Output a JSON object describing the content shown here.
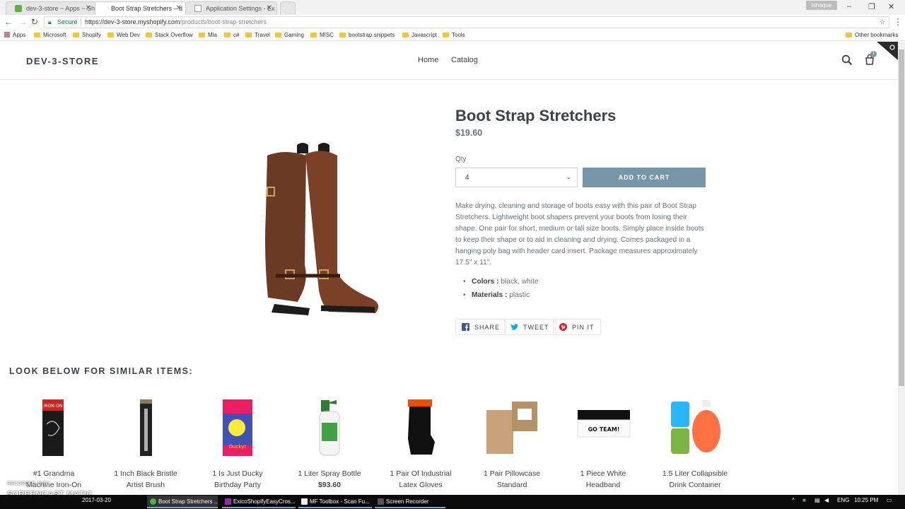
{
  "browser": {
    "tabs": [
      {
        "label": "dev-3-store ~ Apps ~ Sh",
        "active": false
      },
      {
        "label": "Boot Strap Stretchers – d",
        "active": true
      },
      {
        "label": "Application Settings - Ex",
        "active": false
      }
    ],
    "user_badge": "Ishaque",
    "secure_label": "Secure",
    "url_host": "https://dev-3-store.myshopify.com",
    "url_path": "/products/boot-strap-stretchers",
    "bookmarks": [
      "Apps",
      "Microsoft",
      "Shopify",
      "Web Dev",
      "Stack Overflow",
      "Mia",
      "c#",
      "Travel",
      "Gaming",
      "MISC",
      "bootstrap snippets",
      "Javascript",
      "Tools"
    ],
    "other_bookmarks": "Other bookmarks"
  },
  "store": {
    "logo": "DEV-3-STORE",
    "nav": [
      "Home",
      "Catalog"
    ],
    "cart_count": "1"
  },
  "product": {
    "title": "Boot Strap Stretchers",
    "price": "$19.60",
    "qty_label": "Qty",
    "qty_value": "4",
    "add_to_cart": "ADD TO CART",
    "description": "Make drying, cleaning and storage of boots easy with this pair of Boot Strap Stretchers. Lightweight boot shapers prevent your boots from losing their shape. One pair for short, medium or tall size boots. Simply place inside boots to keep their shape or to aid in cleaning and drying. Comes packaged in a hanging poly bag with header card insert. Package measures approximately 17.5\" x 11\".",
    "attributes": [
      {
        "label": "Colors :",
        "value": "black, white"
      },
      {
        "label": "Materials :",
        "value": "plastic"
      }
    ],
    "share": [
      "SHARE",
      "TWEET",
      "PIN IT"
    ]
  },
  "similar": {
    "heading": "LOOK BELOW FOR SIMILAR ITEMS:",
    "items": [
      {
        "line1": "#1 Grandma",
        "line2": "Machine Iron-On",
        "price": ""
      },
      {
        "line1": "1 Inch Black Bristle",
        "line2": "Artist Brush",
        "price": ""
      },
      {
        "line1": "1 Is Just Ducky",
        "line2": "Birthday Party",
        "price": ""
      },
      {
        "line1": "1 Liter Spray Bottle",
        "line2": "",
        "price": "$93.60"
      },
      {
        "line1": "1 Pair Of Industrial",
        "line2": "Latex Gloves",
        "price": ""
      },
      {
        "line1": "1 Pair Pillowcase",
        "line2": "Standard",
        "price": ""
      },
      {
        "line1": "1 Piece White",
        "line2": "Headband",
        "price": ""
      },
      {
        "line1": "1.5 Liter Collapsible",
        "line2": "Drink Container",
        "price": ""
      }
    ]
  },
  "taskbar": {
    "date": "2017-03-20",
    "tasks": [
      "Boot Strap Stretchers ...",
      "ExicoShopifyEasyCros...",
      "MF Toolbox - Scan Fu...",
      "Screen Recorder"
    ],
    "lang": "ENG",
    "time": "10:25 PM"
  },
  "watermark": {
    "recorded": "RECORDED WITH",
    "brand": "SCREENCAST  MATIC"
  },
  "colors": {
    "accent": "#7796a8",
    "text": "#3d4246",
    "muted": "#69727b"
  }
}
